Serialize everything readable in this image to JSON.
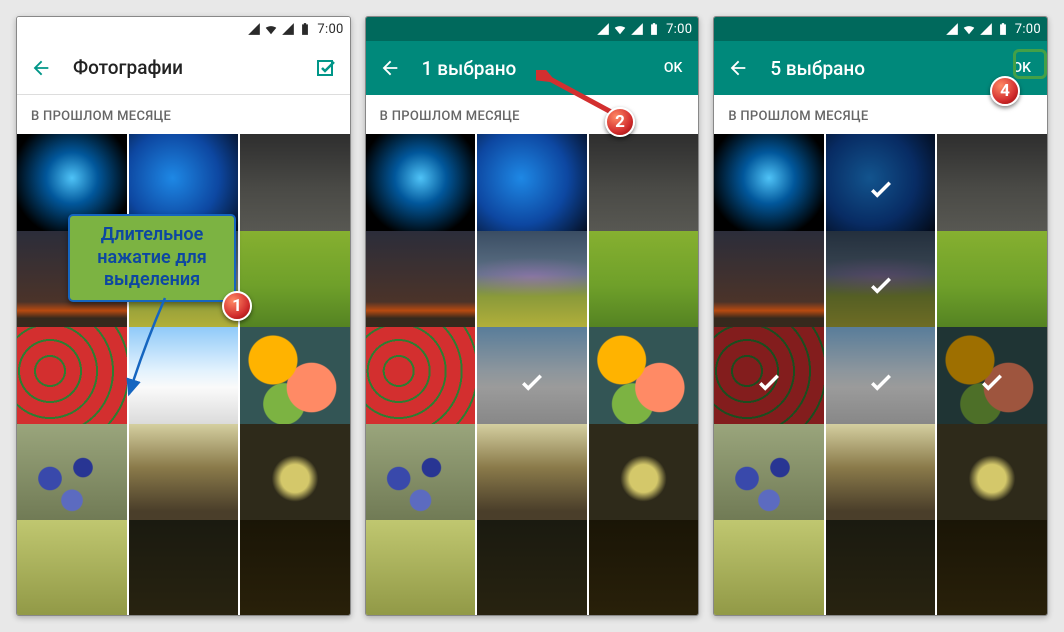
{
  "status": {
    "time": "7:00"
  },
  "screens": [
    {
      "id": "photos",
      "appbar_mode": "light",
      "title": "Фотографии",
      "action": {
        "kind": "icon",
        "name": "multiselect-icon"
      },
      "section": "В ПРОШЛОМ МЕСЯЦЕ",
      "thumbs": [
        "t0",
        "t1",
        "t2",
        "t3",
        "t4",
        "t5",
        "t6",
        "t7",
        "t8",
        "t9",
        "t10",
        "t11",
        "t12",
        "t13",
        "t14"
      ],
      "selected": []
    },
    {
      "id": "sel1",
      "appbar_mode": "teal",
      "title": "1 выбрано",
      "action": {
        "kind": "text",
        "label": "OK"
      },
      "section": "В ПРОШЛОМ МЕСЯЦЕ",
      "thumbs": [
        "t0",
        "t1",
        "t2",
        "t3",
        "t4",
        "t5",
        "t6",
        "t7",
        "t8",
        "t9",
        "t10",
        "t11",
        "t12",
        "t13",
        "t14"
      ],
      "selected": [
        7
      ]
    },
    {
      "id": "sel5",
      "appbar_mode": "teal",
      "title": "5 выбрано",
      "action": {
        "kind": "text",
        "label": "OK"
      },
      "section": "В ПРОШЛОМ МЕСЯЦЕ",
      "thumbs": [
        "t0",
        "t1",
        "t2",
        "t3",
        "t4",
        "t5",
        "t6",
        "t7",
        "t8",
        "t9",
        "t10",
        "t11",
        "t12",
        "t13",
        "t14"
      ],
      "selected": [
        1,
        4,
        6,
        7,
        8
      ]
    }
  ],
  "annotations": {
    "callout_text": "Длительное нажатие для выделения",
    "badges": [
      "1",
      "2",
      "4"
    ]
  }
}
